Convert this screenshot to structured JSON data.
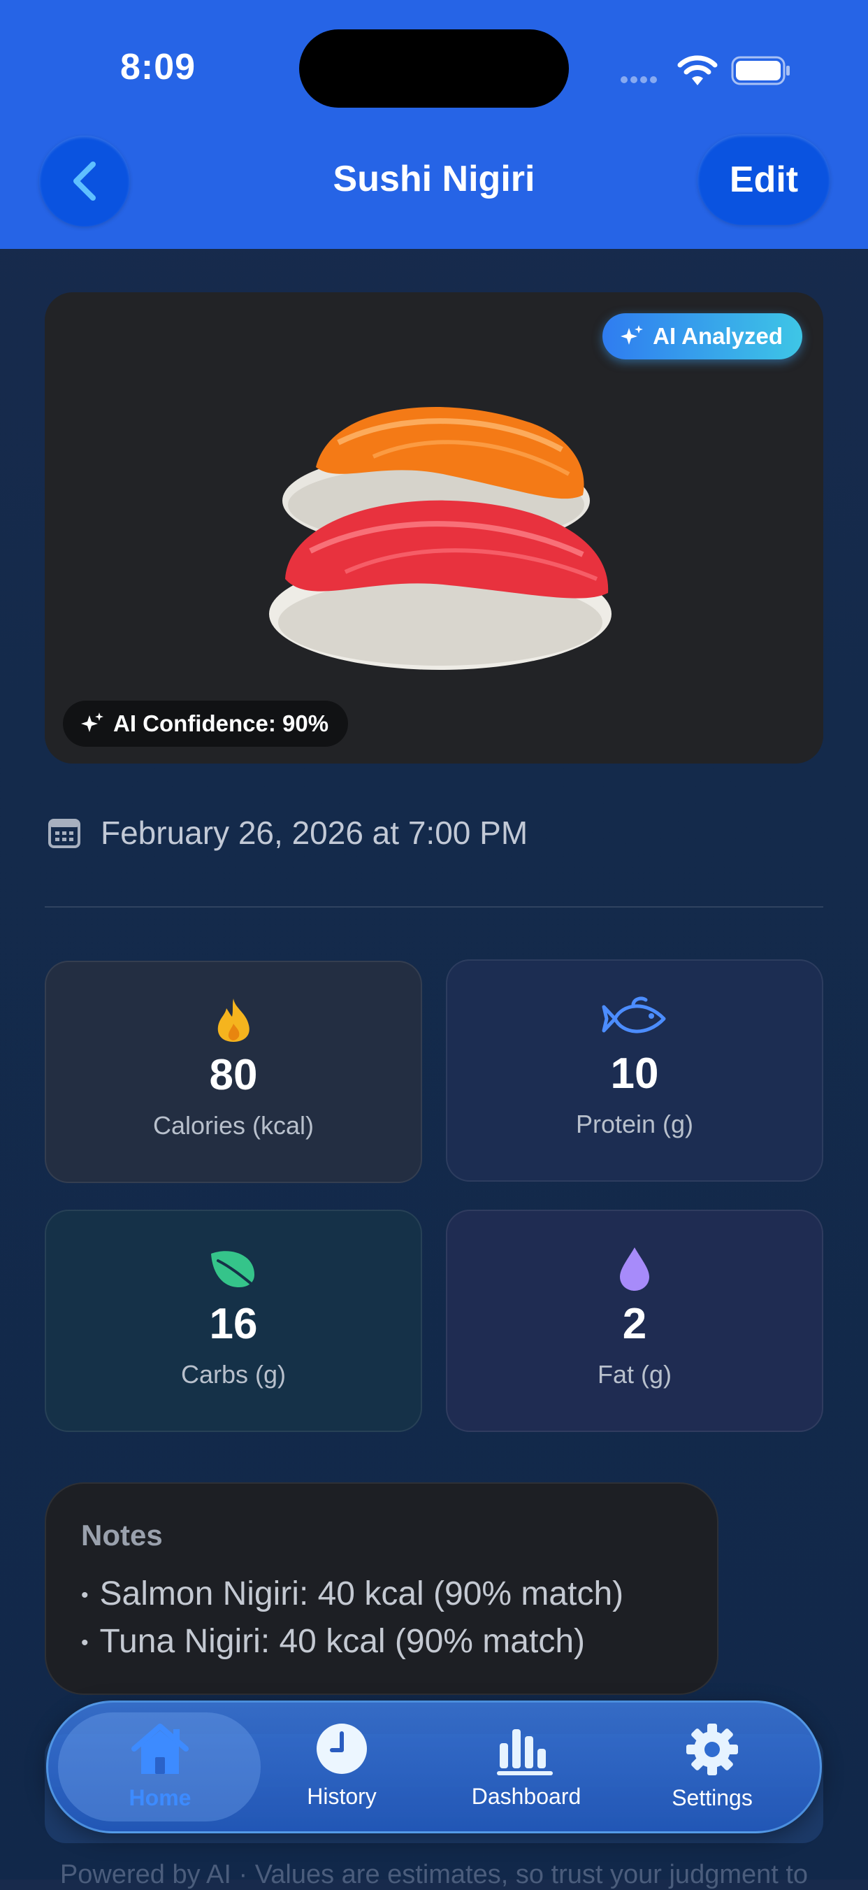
{
  "status_bar": {
    "time": "8:09"
  },
  "header": {
    "title": "Sushi Nigiri",
    "edit_label": "Edit"
  },
  "food_card": {
    "badge": "AI Analyzed",
    "confidence": "AI Confidence: 90%"
  },
  "date": "February 26, 2026 at 7:00 PM",
  "macros": [
    {
      "value": "80",
      "label": "Calories (kcal)",
      "icon": "flame-icon"
    },
    {
      "value": "10",
      "label": "Protein (g)",
      "icon": "fish-icon"
    },
    {
      "value": "16",
      "label": "Carbs (g)",
      "icon": "leaf-icon"
    },
    {
      "value": "2",
      "label": "Fat (g)",
      "icon": "drop-icon"
    }
  ],
  "notes": {
    "title": "Notes",
    "lines": [
      "Salmon Nigiri: 40 kcal (90% match)",
      "Tuna Nigiri: 40 kcal (90% match)"
    ]
  },
  "footer": "Powered by AI · Values are estimates, so trust your judgment to",
  "tabs": [
    {
      "label": "Home",
      "active": true
    },
    {
      "label": "History",
      "active": false
    },
    {
      "label": "Dashboard",
      "active": false
    },
    {
      "label": "Settings",
      "active": false
    }
  ],
  "colors": {
    "header": "#2664e6",
    "accent": "#3d8bff",
    "calories": "#f5b41e",
    "protein": "#4c8dff",
    "carbs": "#35c48a",
    "fat": "#a78bfa"
  }
}
